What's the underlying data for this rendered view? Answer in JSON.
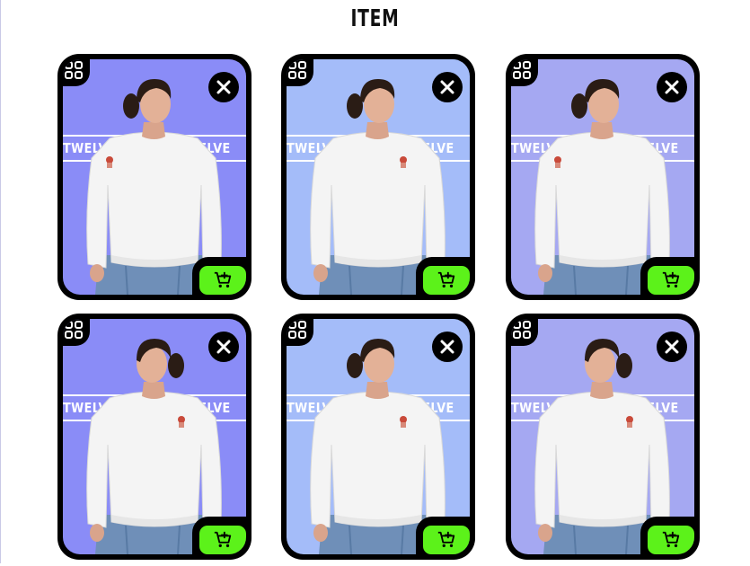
{
  "page": {
    "title": "ITEM"
  },
  "colors": {
    "card_backgrounds": [
      "#8a8cf7",
      "#a4bcf9",
      "#a5a8f2"
    ],
    "cart_button": "#5cf21a",
    "frame": "#000000"
  },
  "icons": {
    "menu": "grid-menu-icon",
    "close": "close-icon",
    "cart": "add-to-cart-icon"
  },
  "items": [
    {
      "band_text": "TWELVE TWELVE TWELVE",
      "pose": "looking-right",
      "bg": "#8a8cf7"
    },
    {
      "band_text": "TWELVE TWELVE TWELVE",
      "pose": "looking-right",
      "bg": "#a4bcf9"
    },
    {
      "band_text": "TWELVE TWELVE TWELVE",
      "pose": "looking-right",
      "bg": "#a5a8f2"
    },
    {
      "band_text": "TWELVE TWELVE TWELVE",
      "pose": "looking-left",
      "bg": "#8a8cf7"
    },
    {
      "band_text": "TWELVE TWELVE TWELVE",
      "pose": "looking-right",
      "bg": "#a4bcf9"
    },
    {
      "band_text": "TWELVE TWELVE TWELVE",
      "pose": "looking-left",
      "bg": "#a5a8f2"
    }
  ]
}
